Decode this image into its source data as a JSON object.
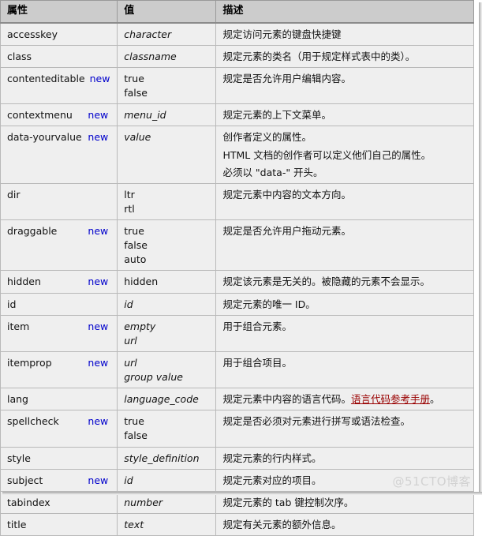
{
  "table": {
    "headers": {
      "attribute": "属性",
      "value": "值",
      "description": "描述"
    },
    "new_label": "new",
    "rows": [
      {
        "attribute": "accesskey",
        "is_new": false,
        "values": [
          {
            "text": "character",
            "italic": true
          }
        ],
        "description": [
          {
            "text": "规定访问元素的键盘快捷键"
          }
        ]
      },
      {
        "attribute": "class",
        "is_new": false,
        "values": [
          {
            "text": "classname",
            "italic": true
          }
        ],
        "description": [
          {
            "text": "规定元素的类名（用于规定样式表中的类）。"
          }
        ]
      },
      {
        "attribute": "contenteditable",
        "is_new": true,
        "values": [
          {
            "text": "true",
            "italic": false
          },
          {
            "text": "false",
            "italic": false
          }
        ],
        "description": [
          {
            "text": "规定是否允许用户编辑内容。"
          }
        ]
      },
      {
        "attribute": "contextmenu",
        "is_new": true,
        "values": [
          {
            "text": "menu_id",
            "italic": true
          }
        ],
        "description": [
          {
            "text": "规定元素的上下文菜单。"
          }
        ]
      },
      {
        "attribute": "data-yourvalue",
        "is_new": true,
        "values": [
          {
            "text": "value",
            "italic": true
          }
        ],
        "description": [
          {
            "text": "创作者定义的属性。"
          },
          {
            "text": "HTML 文档的创作者可以定义他们自己的属性。"
          },
          {
            "text": "必须以 \"data-\" 开头。"
          }
        ]
      },
      {
        "attribute": "dir",
        "is_new": false,
        "values": [
          {
            "text": "ltr",
            "italic": false
          },
          {
            "text": "rtl",
            "italic": false
          }
        ],
        "description": [
          {
            "text": "规定元素中内容的文本方向。"
          }
        ]
      },
      {
        "attribute": "draggable",
        "is_new": true,
        "values": [
          {
            "text": "true",
            "italic": false
          },
          {
            "text": "false",
            "italic": false
          },
          {
            "text": "auto",
            "italic": false
          }
        ],
        "description": [
          {
            "text": "规定是否允许用户拖动元素。"
          }
        ]
      },
      {
        "attribute": "hidden",
        "is_new": true,
        "values": [
          {
            "text": "hidden",
            "italic": false
          }
        ],
        "description": [
          {
            "text": "规定该元素是无关的。被隐藏的元素不会显示。"
          }
        ]
      },
      {
        "attribute": "id",
        "is_new": false,
        "values": [
          {
            "text": "id",
            "italic": true
          }
        ],
        "description": [
          {
            "text": "规定元素的唯一 ID。"
          }
        ]
      },
      {
        "attribute": "item",
        "is_new": true,
        "values": [
          {
            "text": "empty",
            "italic": true
          },
          {
            "text": "url",
            "italic": true
          }
        ],
        "description": [
          {
            "text": "用于组合元素。"
          }
        ]
      },
      {
        "attribute": "itemprop",
        "is_new": true,
        "values": [
          {
            "text": "url",
            "italic": true
          },
          {
            "text": "group value",
            "italic": true
          }
        ],
        "description": [
          {
            "text": "用于组合项目。"
          }
        ]
      },
      {
        "attribute": "lang",
        "is_new": false,
        "values": [
          {
            "text": "language_code",
            "italic": true
          }
        ],
        "description": [
          {
            "text": "规定元素中内容的语言代码。",
            "link_text": "语言代码参考手册",
            "text_after": "。"
          }
        ]
      },
      {
        "attribute": "spellcheck",
        "is_new": true,
        "values": [
          {
            "text": "true",
            "italic": false
          },
          {
            "text": "false",
            "italic": false
          }
        ],
        "description": [
          {
            "text": "规定是否必须对元素进行拼写或语法检查。"
          }
        ]
      },
      {
        "attribute": "style",
        "is_new": false,
        "values": [
          {
            "text": "style_definition",
            "italic": true
          }
        ],
        "description": [
          {
            "text": "规定元素的行内样式。"
          }
        ]
      },
      {
        "attribute": "subject",
        "is_new": true,
        "values": [
          {
            "text": "id",
            "italic": true
          }
        ],
        "description": [
          {
            "text": "规定元素对应的项目。"
          }
        ]
      },
      {
        "attribute": "tabindex",
        "is_new": false,
        "values": [
          {
            "text": "number",
            "italic": true
          }
        ],
        "description": [
          {
            "text": "规定元素的 tab 键控制次序。"
          }
        ]
      },
      {
        "attribute": "title",
        "is_new": false,
        "values": [
          {
            "text": "text",
            "italic": true
          }
        ],
        "description": [
          {
            "text": "规定有关元素的额外信息。"
          }
        ]
      }
    ]
  },
  "watermark": "@51CTO博客",
  "colors": {
    "new_badge": "#0000cc",
    "link": "#990000",
    "header_bg": "#cccccc",
    "cell_bg": "#efefef",
    "border": "#b9b9b9"
  }
}
